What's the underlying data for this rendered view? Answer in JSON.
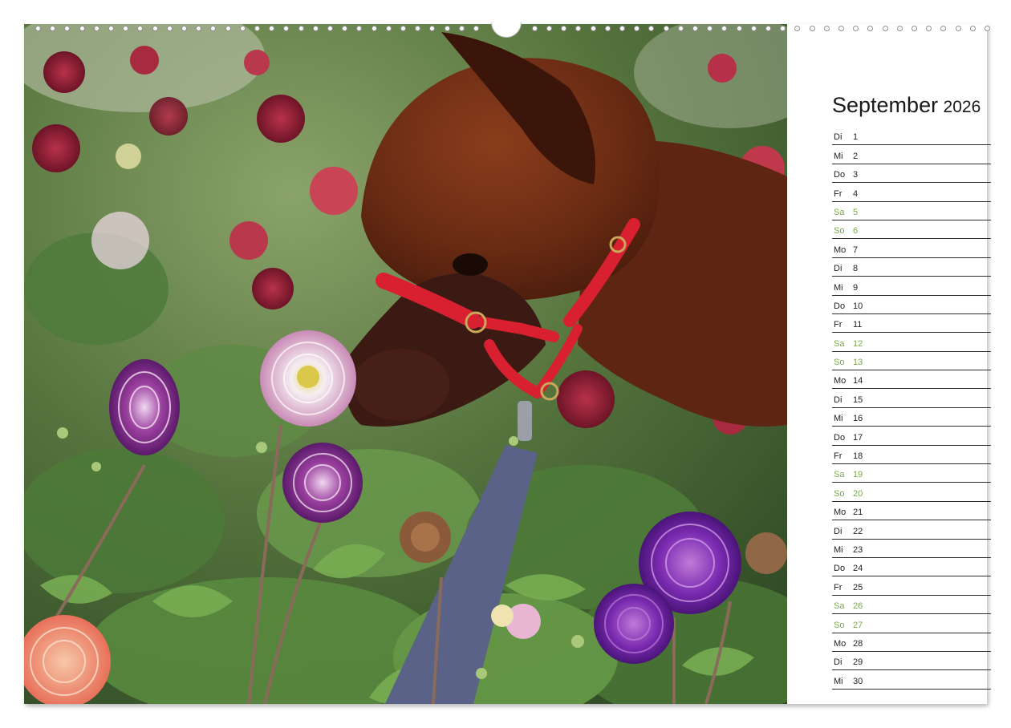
{
  "calendar": {
    "month": "September",
    "year": "2026",
    "weekend_color": "#7aa84a",
    "days": [
      {
        "wd": "Di",
        "d": "1",
        "weekend": false
      },
      {
        "wd": "Mi",
        "d": "2",
        "weekend": false
      },
      {
        "wd": "Do",
        "d": "3",
        "weekend": false
      },
      {
        "wd": "Fr",
        "d": "4",
        "weekend": false
      },
      {
        "wd": "Sa",
        "d": "5",
        "weekend": true
      },
      {
        "wd": "So",
        "d": "6",
        "weekend": true
      },
      {
        "wd": "Mo",
        "d": "7",
        "weekend": false
      },
      {
        "wd": "Di",
        "d": "8",
        "weekend": false
      },
      {
        "wd": "Mi",
        "d": "9",
        "weekend": false
      },
      {
        "wd": "Do",
        "d": "10",
        "weekend": false
      },
      {
        "wd": "Fr",
        "d": "11",
        "weekend": false
      },
      {
        "wd": "Sa",
        "d": "12",
        "weekend": true
      },
      {
        "wd": "So",
        "d": "13",
        "weekend": true
      },
      {
        "wd": "Mo",
        "d": "14",
        "weekend": false
      },
      {
        "wd": "Di",
        "d": "15",
        "weekend": false
      },
      {
        "wd": "Mi",
        "d": "16",
        "weekend": false
      },
      {
        "wd": "Do",
        "d": "17",
        "weekend": false
      },
      {
        "wd": "Fr",
        "d": "18",
        "weekend": false
      },
      {
        "wd": "Sa",
        "d": "19",
        "weekend": true
      },
      {
        "wd": "So",
        "d": "20",
        "weekend": true
      },
      {
        "wd": "Mo",
        "d": "21",
        "weekend": false
      },
      {
        "wd": "Di",
        "d": "22",
        "weekend": false
      },
      {
        "wd": "Mi",
        "d": "23",
        "weekend": false
      },
      {
        "wd": "Do",
        "d": "24",
        "weekend": false
      },
      {
        "wd": "Fr",
        "d": "25",
        "weekend": false
      },
      {
        "wd": "Sa",
        "d": "26",
        "weekend": true
      },
      {
        "wd": "So",
        "d": "27",
        "weekend": true
      },
      {
        "wd": "Mo",
        "d": "28",
        "weekend": false
      },
      {
        "wd": "Di",
        "d": "29",
        "weekend": false
      },
      {
        "wd": "Mi",
        "d": "30",
        "weekend": false
      }
    ]
  }
}
